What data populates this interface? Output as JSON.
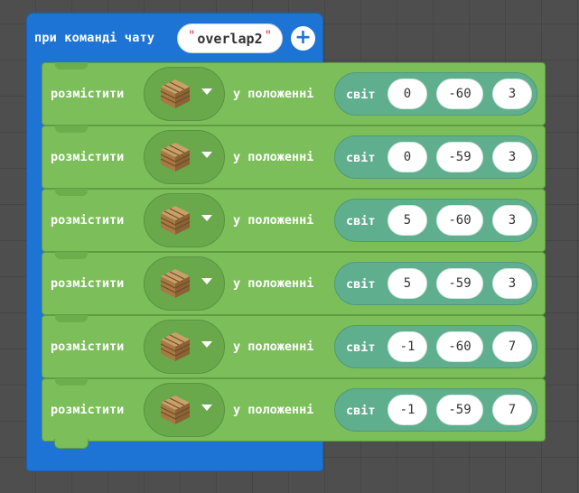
{
  "hat": {
    "label": "при команді чату",
    "command": "overlap2",
    "quote_open": "\"",
    "quote_close": "\"",
    "add_icon": "plus-icon",
    "color": "#1e74d4"
  },
  "blocks": [
    {
      "place_label": "розмістити",
      "item_icon": "oak-planks-icon",
      "position_label": "у положенні",
      "world_label": "світ",
      "x": "0",
      "y": "-60",
      "z": "3"
    },
    {
      "place_label": "розмістити",
      "item_icon": "oak-planks-icon",
      "position_label": "у положенні",
      "world_label": "світ",
      "x": "0",
      "y": "-59",
      "z": "3"
    },
    {
      "place_label": "розмістити",
      "item_icon": "oak-planks-icon",
      "position_label": "у положенні",
      "world_label": "світ",
      "x": "5",
      "y": "-60",
      "z": "3"
    },
    {
      "place_label": "розмістити",
      "item_icon": "oak-planks-icon",
      "position_label": "у положенні",
      "world_label": "світ",
      "x": "5",
      "y": "-59",
      "z": "3"
    },
    {
      "place_label": "розмістити",
      "item_icon": "oak-planks-icon",
      "position_label": "у положенні",
      "world_label": "світ",
      "x": "-1",
      "y": "-60",
      "z": "7"
    },
    {
      "place_label": "розмістити",
      "item_icon": "oak-planks-icon",
      "position_label": "у положенні",
      "world_label": "світ",
      "x": "-1",
      "y": "-59",
      "z": "7"
    }
  ],
  "colors": {
    "block": "#7cbf5a",
    "world": "#5fae8e",
    "hat": "#1e74d4"
  }
}
